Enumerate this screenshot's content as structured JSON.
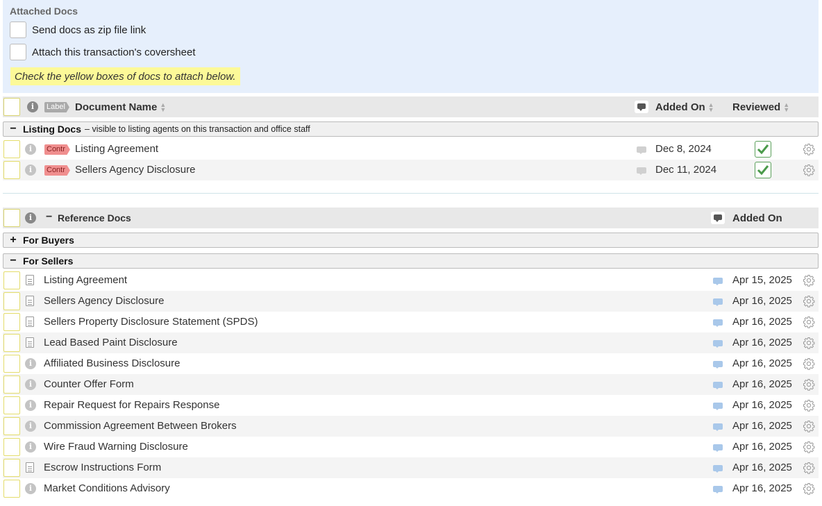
{
  "attached": {
    "heading": "Attached Docs",
    "option_zip": "Send docs as zip file link",
    "option_coversheet": "Attach this transaction's coversheet",
    "hint": "Check the yellow boxes of docs to attach below."
  },
  "main_header": {
    "label_tag": "Label",
    "col_name": "Document Name",
    "col_added": "Added On",
    "col_reviewed": "Reviewed"
  },
  "listing_group": {
    "sign": "−",
    "name": "Listing Docs",
    "desc": "– visible to listing agents on this transaction and office staff"
  },
  "listing_docs": [
    {
      "tag": "Contr",
      "name": "Listing Agreement",
      "date": "Dec 8, 2024"
    },
    {
      "tag": "Contr",
      "name": "Sellers Agency Disclosure",
      "date": "Dec 11, 2024"
    }
  ],
  "ref_header": {
    "sign": "−",
    "title": "Reference Docs",
    "col_added": "Added On"
  },
  "buyers_group": {
    "sign": "+",
    "name": "For Buyers"
  },
  "sellers_group": {
    "sign": "−",
    "name": "For Sellers"
  },
  "seller_docs": [
    {
      "icon": "document-icon",
      "name": "Listing Agreement",
      "date": "Apr 15, 2025"
    },
    {
      "icon": "document-icon",
      "name": "Sellers Agency Disclosure",
      "date": "Apr 16, 2025"
    },
    {
      "icon": "document-icon",
      "name": "Sellers Property Disclosure Statement (SPDS)",
      "date": "Apr 16, 2025"
    },
    {
      "icon": "document-icon",
      "name": "Lead Based Paint Disclosure",
      "date": "Apr 16, 2025"
    },
    {
      "icon": "info-icon",
      "name": "Affiliated Business Disclosure",
      "date": "Apr 16, 2025"
    },
    {
      "icon": "info-icon",
      "name": "Counter Offer Form",
      "date": "Apr 16, 2025"
    },
    {
      "icon": "info-icon",
      "name": "Repair Request for Repairs Response",
      "date": "Apr 16, 2025"
    },
    {
      "icon": "info-icon",
      "name": "Commission Agreement Between Brokers",
      "date": "Apr 16, 2025"
    },
    {
      "icon": "info-icon",
      "name": "Wire Fraud Warning Disclosure",
      "date": "Apr 16, 2025"
    },
    {
      "icon": "document-icon",
      "name": "Escrow Instructions Form",
      "date": "Apr 16, 2025"
    },
    {
      "icon": "info-icon",
      "name": "Market Conditions Advisory",
      "date": "Apr 16, 2025"
    }
  ],
  "colors": {
    "panel_bg": "#e6effc",
    "hint_bg": "#fcf998",
    "contr_tag": "#f08f8f",
    "reviewed_check": "#5aa05a",
    "comment_blue": "#a9c8ea"
  }
}
